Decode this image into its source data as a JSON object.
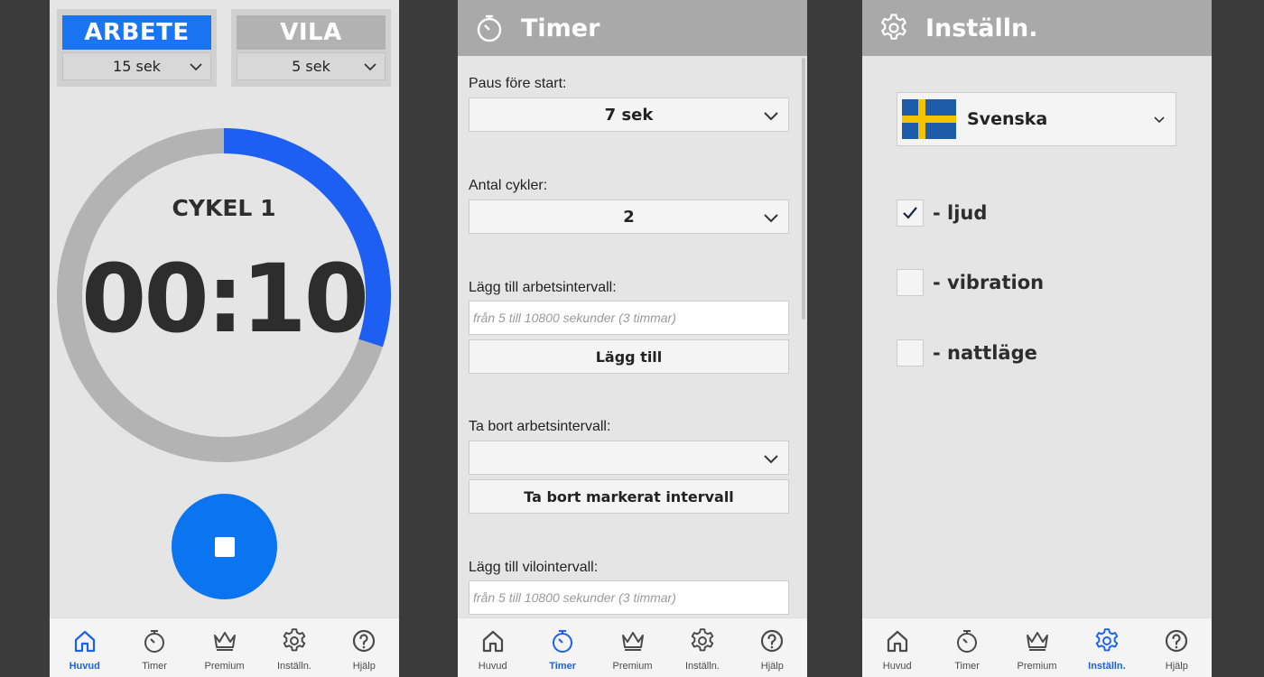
{
  "nav": {
    "items": [
      {
        "label": "Huvud",
        "icon": "home-icon"
      },
      {
        "label": "Timer",
        "icon": "stopwatch-icon"
      },
      {
        "label": "Premium",
        "icon": "crown-icon"
      },
      {
        "label": "Inställn.",
        "icon": "gear-icon"
      },
      {
        "label": "Hjälp",
        "icon": "help-icon"
      }
    ],
    "active_color": "#1a62e8"
  },
  "main": {
    "work": {
      "title": "ARBETE",
      "value": "15 sek"
    },
    "rest": {
      "title": "VILA",
      "value": "5 sek"
    },
    "cycle_label": "CYKEL 1",
    "time": "00:10",
    "progress_fraction": 0.3,
    "accent_color": "#1a75f2"
  },
  "timer": {
    "title": "Timer",
    "pause_label": "Paus före start:",
    "pause_value": "7 sek",
    "cycles_label": "Antal cykler:",
    "cycles_value": "2",
    "add_work_label": "Lägg till arbetsintervall:",
    "add_work_placeholder": "från 5 till 10800 sekunder (3 timmar)",
    "add_button": "Lägg till",
    "remove_work_label": "Ta bort arbetsintervall:",
    "remove_work_value": "",
    "remove_button": "Ta bort markerat intervall",
    "add_rest_label": "Lägg till vilointervall:",
    "add_rest_placeholder": "från 5 till 10800 sekunder (3 timmar)"
  },
  "settings": {
    "title": "Inställn.",
    "language": "Svenska",
    "flag_icon": "sweden-flag-icon",
    "options": [
      {
        "label": "- ljud",
        "checked": true
      },
      {
        "label": "- vibration",
        "checked": false
      },
      {
        "label": "- nattläge",
        "checked": false
      }
    ]
  }
}
